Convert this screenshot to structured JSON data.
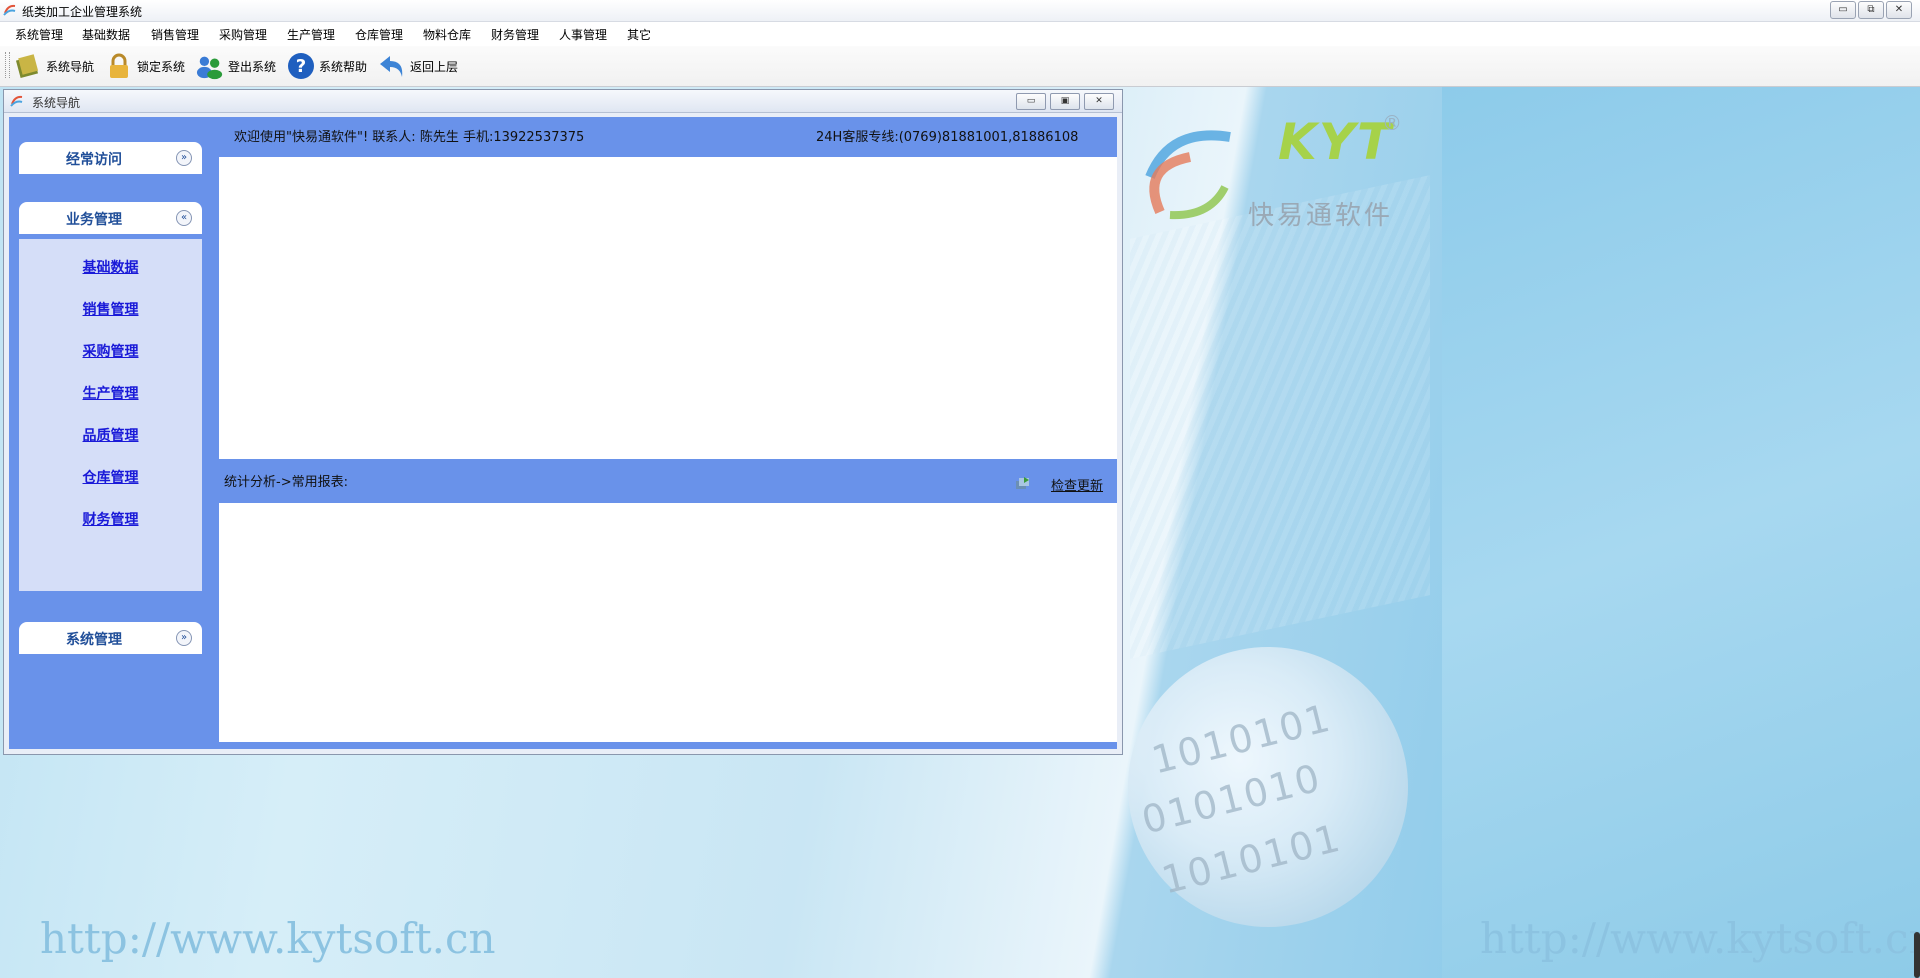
{
  "window": {
    "title": "纸类加工企业管理系统",
    "controls": [
      "▭",
      "⧉",
      "✕"
    ]
  },
  "menu": [
    "系统管理",
    "基础数据",
    "销售管理",
    "采购管理",
    "生产管理",
    "仓库管理",
    "物料仓库",
    "财务管理",
    "人事管理",
    "其它"
  ],
  "toolbar": [
    {
      "label": "系统导航",
      "icon": "book-icon"
    },
    {
      "label": "锁定系统",
      "icon": "lock-icon"
    },
    {
      "label": "登出系统",
      "icon": "users-icon"
    },
    {
      "label": "系统帮助",
      "icon": "help-icon"
    },
    {
      "label": "返回上层",
      "icon": "back-arrow-icon"
    }
  ],
  "child": {
    "title": "系统导航",
    "controls": [
      "▭",
      "▣",
      "✕"
    ],
    "sidebar": {
      "frequent": {
        "label": "经常访问",
        "toggle": "»"
      },
      "business": {
        "label": "业务管理",
        "toggle": "«",
        "links": [
          "基础数据",
          "销售管理",
          "采购管理",
          "生产管理",
          "品质管理",
          "仓库管理",
          "财务管理"
        ]
      },
      "system": {
        "label": "系统管理",
        "toggle": "»"
      }
    },
    "welcome": "欢迎使用\"快易通软件\"! 联系人: 陈先生 手机:13922537375",
    "hotline": "24H客服专线:(0769)81881001,81886108",
    "report_title": "统计分析->常用报表:",
    "check_update": "检查更新"
  },
  "background": {
    "logo_text": "KYT",
    "logo_reg": "®",
    "logo_cn": "快易通软件",
    "watermark": "http://www.kytsoft.cn",
    "binary1": "1010101",
    "binary2": "0101010",
    "binary3": "1010101"
  },
  "colors": {
    "panel_blue": "#6992ea",
    "sidebar_light": "#d5def8",
    "link_blue": "#1a1ad8",
    "header_text": "#214f99"
  }
}
